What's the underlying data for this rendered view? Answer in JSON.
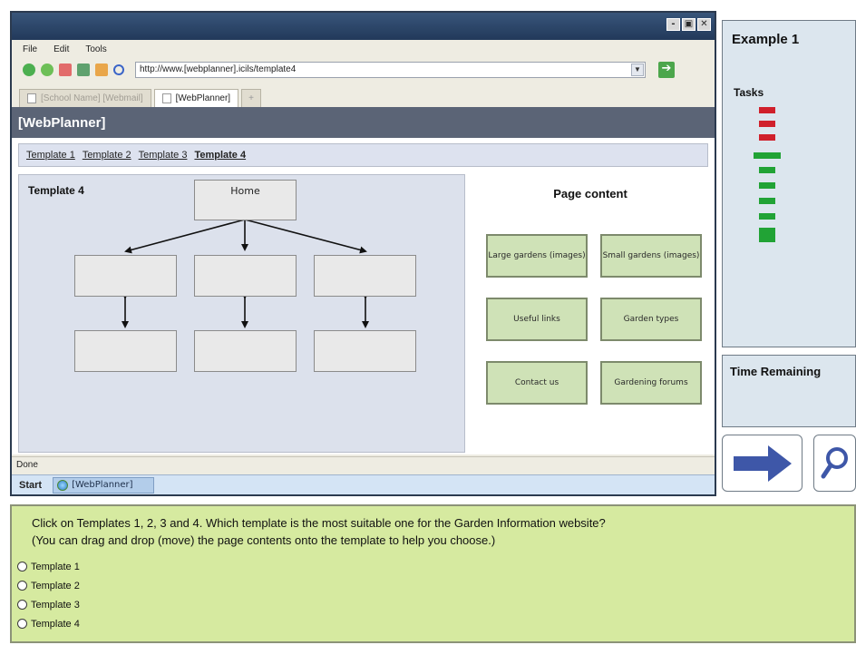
{
  "window": {
    "controls": [
      "-",
      "▣",
      "✕"
    ]
  },
  "menu": [
    "File",
    "Edit",
    "Tools"
  ],
  "toolbar": {
    "icons": [
      "back-icon",
      "forward-icon",
      "stop-icon",
      "refresh-icon",
      "home-icon",
      "search-icon"
    ],
    "address": "http://www.[webplanner].icils/template4",
    "go_icon": "go-arrow-icon"
  },
  "tabs": [
    {
      "label": "[School Name] [Webmail]",
      "active": false
    },
    {
      "label": "[WebPlanner]",
      "active": true
    },
    {
      "label": "+",
      "active": false
    }
  ],
  "page": {
    "header": "[WebPlanner]",
    "template_links": [
      "Template 1",
      "Template 2",
      "Template 3",
      "Template 4"
    ],
    "current_template": "Template 4",
    "template_label": "Template 4",
    "home_label": "Home",
    "content_title": "Page content",
    "cards": [
      "Large gardens (images)",
      "Small gardens (images)",
      "Useful links",
      "Garden types",
      "Contact us",
      "Gardening forums"
    ]
  },
  "status": "Done",
  "taskbar": {
    "start": "Start",
    "item": "[WebPlanner]"
  },
  "side": {
    "example_title": "Example 1",
    "tasks_title": "Tasks",
    "tasks": [
      {
        "status": "wrong",
        "color": "#d0202b"
      },
      {
        "status": "wrong",
        "color": "#d0202b"
      },
      {
        "status": "wrong",
        "color": "#d0202b"
      },
      {
        "status": "current",
        "color": "#21a335"
      },
      {
        "status": "pending",
        "color": "#21a335"
      },
      {
        "status": "pending",
        "color": "#21a335"
      },
      {
        "status": "pending",
        "color": "#21a335"
      },
      {
        "status": "pending",
        "color": "#21a335"
      },
      {
        "status": "last",
        "color": "#21a335"
      }
    ],
    "time_title": "Time Remaining",
    "next_icon": "arrow-right-icon",
    "zoom_icon": "magnifier-icon"
  },
  "question": {
    "line1": "Click on Templates 1, 2, 3 and 4. Which template is the most suitable one for the Garden Information website?",
    "line2": "(You can drag and drop (move) the page contents onto the template to help you choose.)",
    "options": [
      "Template 1",
      "Template 2",
      "Template 3",
      "Template 4"
    ]
  },
  "colors": {
    "accent_blue": "#3e57a8",
    "header_gray": "#5b6476",
    "question_bg": "#d6eaa0",
    "card_bg": "#cfe2b7"
  }
}
